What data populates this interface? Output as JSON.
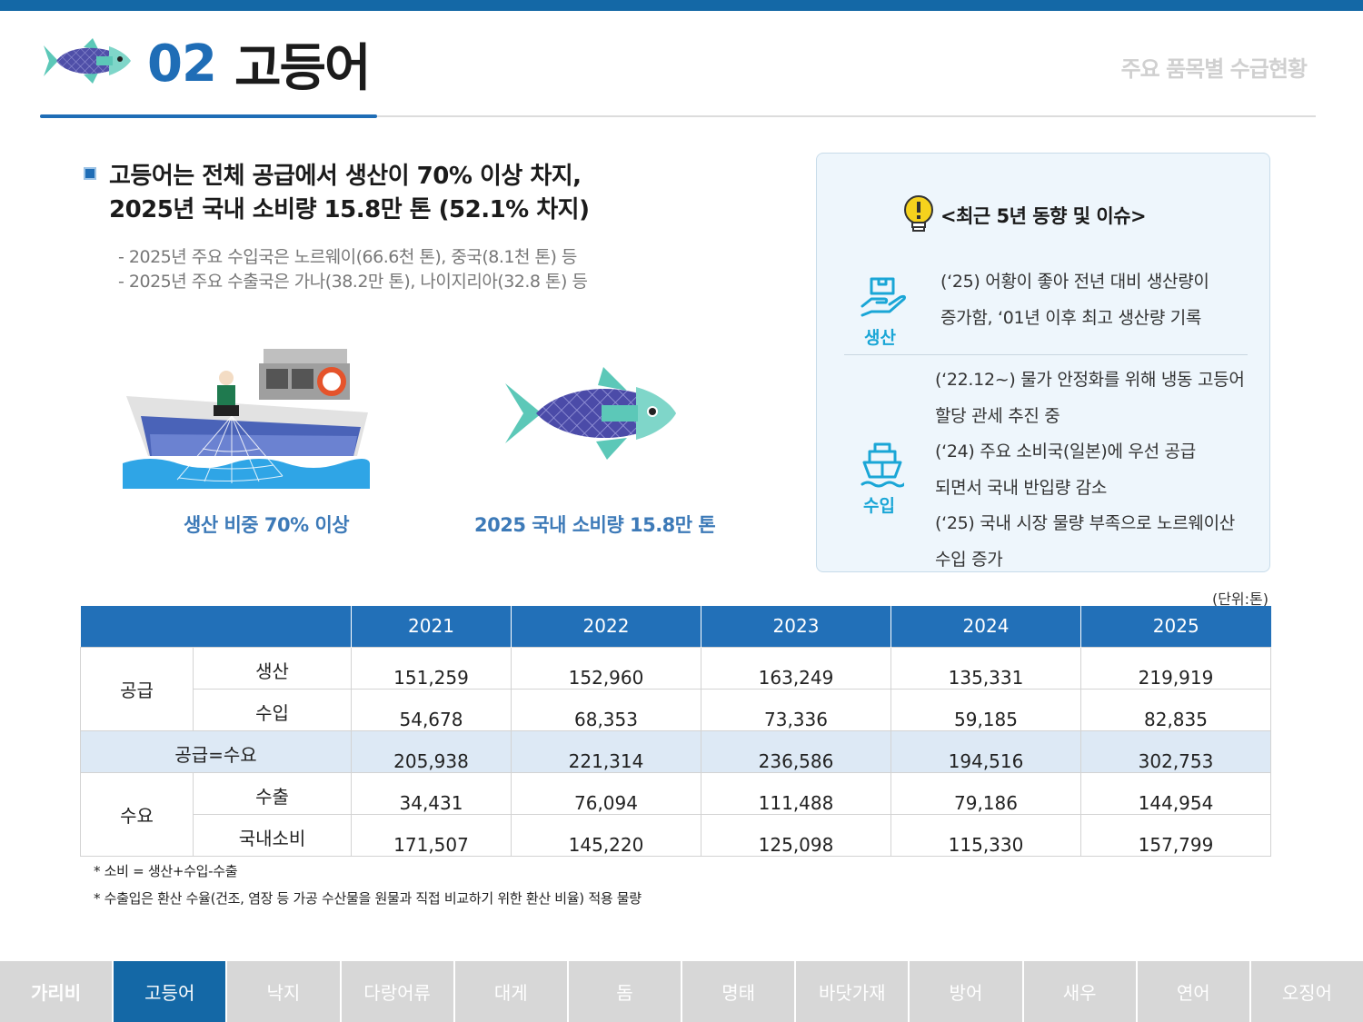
{
  "header": {
    "number": "02",
    "title": "고등어",
    "section": "주요 품목별 수급현황"
  },
  "headline": {
    "line1": "고등어는 전체 공급에서 생산이 70% 이상 차지,",
    "line2": "2025년 국내 소비량 15.8만 톤 (52.1% 차지)"
  },
  "notes": [
    "- 2025년 주요 수입국은 노르웨이(66.6천 톤), 중국(8.1천 톤) 등",
    "- 2025년 주요 수출국은 가나(38.2만 톤), 나이지리아(32.8 톤) 등"
  ],
  "captions": {
    "production": "생산 비중 70% 이상",
    "consumption": "2025 국내 소비량 15.8만 톤"
  },
  "issues": {
    "title": "<최근 5년 동향 및 이슈>",
    "production": {
      "label": "생산",
      "lines": [
        "(‘25) 어황이 좋아 전년 대비 생산량이",
        "증가함, ‘01년 이후 최고 생산량 기록"
      ]
    },
    "import": {
      "label": "수입",
      "lines": [
        "(‘22.12~) 물가 안정화를 위해 냉동 고등어",
        "할당 관세 추진 중",
        "(‘24) 주요 소비국(일본)에 우선 공급",
        "되면서 국내 반입량 감소",
        "(‘25) 국내 시장 물량 부족으로 노르웨이산",
        "수입 증가"
      ]
    }
  },
  "table": {
    "unit": "(단위:톤)",
    "years": [
      "2021",
      "2022",
      "2023",
      "2024",
      "2025"
    ],
    "supply_label": "공급",
    "demand_label": "수요",
    "rows": {
      "production": {
        "label": "생산",
        "values": [
          "151,259",
          "152,960",
          "163,249",
          "135,331",
          "219,919"
        ]
      },
      "import": {
        "label": "수입",
        "values": [
          "54,678",
          "68,353",
          "73,336",
          "59,185",
          "82,835"
        ]
      },
      "total": {
        "label": "공급=수요",
        "values": [
          "205,938",
          "221,314",
          "236,586",
          "194,516",
          "302,753"
        ]
      },
      "export": {
        "label": "수출",
        "values": [
          "34,431",
          "76,094",
          "111,488",
          "79,186",
          "144,954"
        ]
      },
      "domestic": {
        "label": "국내소비",
        "values": [
          "171,507",
          "145,220",
          "125,098",
          "115,330",
          "157,799"
        ]
      }
    }
  },
  "footnotes": [
    "* 소비 = 생산+수입-수출",
    "* 수출입은 환산 수율(건조, 염장 등 가공 수산물을 원물과 직접 비교하기 위한 환산 비율) 적용 물량"
  ],
  "tabs": [
    "가리비",
    "고등어",
    "낙지",
    "다랑어류",
    "대게",
    "돔",
    "명태",
    "바닷가재",
    "방어",
    "새우",
    "연어",
    "오징어"
  ],
  "active_tab": "고등어",
  "colors": {
    "accent": "#1f6db6",
    "tab_active": "#1468a6",
    "tab_inactive": "#d7d7d7",
    "table_header": "#2270b8",
    "total_row": "#dde9f5",
    "issue_label": "#1aa6d6"
  }
}
